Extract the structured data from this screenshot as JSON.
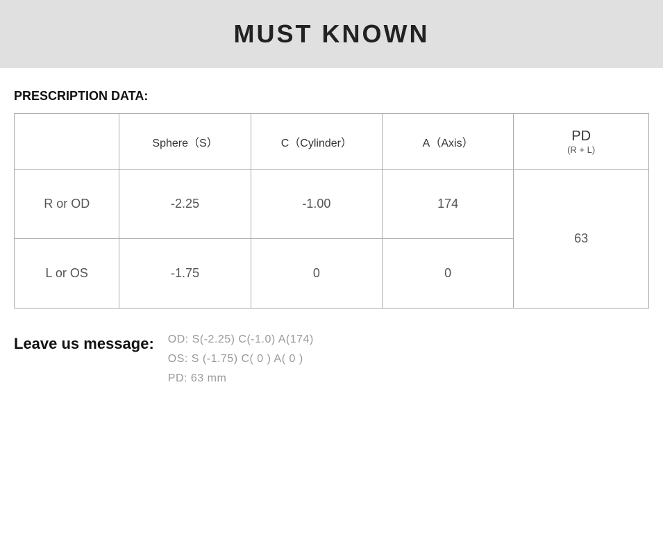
{
  "header": {
    "title": "MUST KNOWN"
  },
  "prescription": {
    "section_label": "PRESCRIPTION DATA:",
    "columns": {
      "row_header": "",
      "sphere": "Sphere（S）",
      "cylinder": "C（Cylinder）",
      "axis": "A（Axis）",
      "pd_main": "PD",
      "pd_sub": "(R + L)"
    },
    "rows": [
      {
        "label": "R or OD",
        "sphere": "-2.25",
        "cylinder": "-1.00",
        "axis": "174",
        "pd": "63"
      },
      {
        "label": "L or OS",
        "sphere": "-1.75",
        "cylinder": "0",
        "axis": "0",
        "pd": ""
      }
    ]
  },
  "leave_message": {
    "label": "Leave us message:",
    "lines": [
      "OD:  S(-2.25)    C(-1.0)   A(174)",
      "OS:  S (-1.75)    C( 0 )    A( 0 )",
      "PD:  63 mm"
    ]
  }
}
